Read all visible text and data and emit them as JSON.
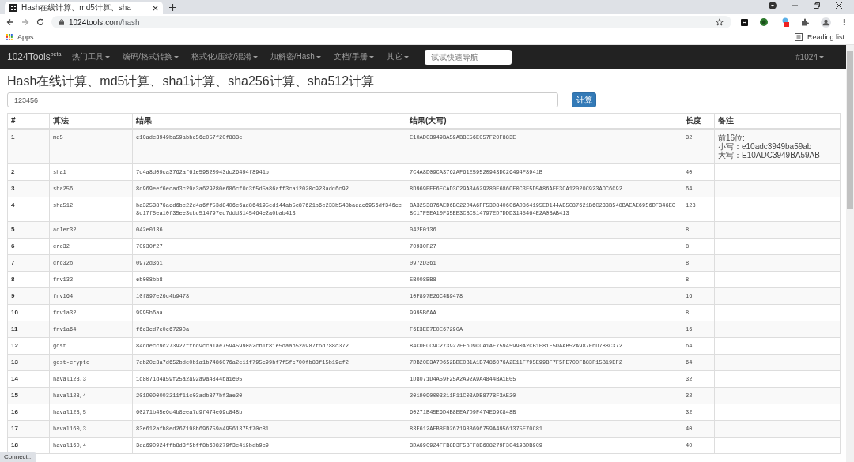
{
  "browser": {
    "tab": {
      "title": "Hash在线计算、md5计算、sha"
    },
    "url": {
      "host": "1024tools.com",
      "path": "/hash"
    },
    "bookmarks": [
      "Apps"
    ],
    "reading_list": "Reading list"
  },
  "navbar": {
    "brand": "1024Tools",
    "brand_sup": "beta",
    "menus": [
      "热门工具",
      "编码/格式转换",
      "格式化/压缩/混淆",
      "加解密/Hash",
      "文档/手册",
      "其它"
    ],
    "search_placeholder": "试试快速导航",
    "right_menu": "#1024"
  },
  "heading": "Hash在线计算、md5计算、sha1计算、sha256计算、sha512计算",
  "input": {
    "value": "123456"
  },
  "submit": "计算",
  "table": {
    "columns": [
      "#",
      "算法",
      "结果",
      "结果(大写)",
      "长度",
      "备注"
    ],
    "rows": [
      {
        "no": "1",
        "algo": "md5",
        "hash": "e10adc3949ba59abbe56e057f20f883e",
        "hash_upper": "E10ADC3949BA59ABBE56E057F20F883E",
        "length": "32",
        "note": [
          "前16位:",
          "小写：e10adc3949ba59ab",
          "大写：E10ADC3949BA59AB"
        ]
      },
      {
        "no": "2",
        "algo": "sha1",
        "hash": "7c4a8d09ca3762af61e59520943dc26494f8941b",
        "hash_upper": "7C4A8D09CA3762AF61E59520943DC26494F8941B",
        "length": "40"
      },
      {
        "no": "3",
        "algo": "sha256",
        "hash": "8d969eef6ecad3c29a3a629280e686cf0c3f5d5a86aff3ca12020c923adc6c92",
        "hash_upper": "8D969EEF6ECAD3C29A3A629280E686CF0C3F5D5A86AFF3CA12020C923ADC6C92",
        "length": "64"
      },
      {
        "no": "4",
        "algo": "sha512",
        "hash": "ba3253876aed6bc22d4a6ff53d8406c6ad864195ed144ab5c87621b6c233b548baeae6956df346ec8c17f5ea10f35ee3cbc514797ed7ddd3145464e2a0bab413",
        "hash_upper": "BA3253876AED6BC22D4A6FF53D8406C6AD864195ED144AB5C87621B6C233B548BAEAE6956DF346EC8C17F5EA10F35EE3CBC514797ED7DDD3145464E2A0BAB413",
        "length": "128"
      },
      {
        "no": "5",
        "algo": "adler32",
        "hash": "042e0136",
        "hash_upper": "042E0136",
        "length": "8"
      },
      {
        "no": "6",
        "algo": "crc32",
        "hash": "70930f27",
        "hash_upper": "70930F27",
        "length": "8"
      },
      {
        "no": "7",
        "algo": "crc32b",
        "hash": "0972d361",
        "hash_upper": "0972D361",
        "length": "8"
      },
      {
        "no": "8",
        "algo": "fnv132",
        "hash": "eb008bb8",
        "hash_upper": "EB008BB8",
        "length": "8"
      },
      {
        "no": "9",
        "algo": "fnv164",
        "hash": "10f897e26c4b9478",
        "hash_upper": "10F897E26C4B9478",
        "length": "16"
      },
      {
        "no": "10",
        "algo": "fnv1a32",
        "hash": "9995b6aa",
        "hash_upper": "9995B6AA",
        "length": "8"
      },
      {
        "no": "11",
        "algo": "fnv1a64",
        "hash": "f6e3ed7e0e67290a",
        "hash_upper": "F6E3ED7E0E67290A",
        "length": "16"
      },
      {
        "no": "12",
        "algo": "gost",
        "hash": "84cdecc9c273927ff6d9cca1ae75945990a2cb1f81e5daab52a987f6d788c372",
        "hash_upper": "84CDECC9C273927FF6D9CCA1AE75945990A2CB1F81E5DAAB52A987F6D788C372",
        "length": "64"
      },
      {
        "no": "13",
        "algo": "gost-crypto",
        "hash": "7db20e3a7d652bde0b1a1b7486076a2e11f795e99bf7f5fe700fb83f15b19ef2",
        "hash_upper": "7DB20E3A7D652BDE0B1A1B7486076A2E11F795E99BF7F5FE700FB83F15B19EF2",
        "length": "64"
      },
      {
        "no": "14",
        "algo": "haval128,3",
        "hash": "1d8071d4a59f25a2a92a9a4844ba1e05",
        "hash_upper": "1D8071D4A59F25A2A92A9A4844BA1E05",
        "length": "32"
      },
      {
        "no": "15",
        "algo": "haval128,4",
        "hash": "2019090003211f11c03adb877bf3ae20",
        "hash_upper": "2019090003211F11C03ADB877BF3AE20",
        "length": "32"
      },
      {
        "no": "16",
        "algo": "haval128,5",
        "hash": "60271b45e6d4b8eea7d9f474e69c848b",
        "hash_upper": "60271B45E6D4B8EEA7D9F474E69C848B",
        "length": "32"
      },
      {
        "no": "17",
        "algo": "haval160,3",
        "hash": "83e612afb8ed267198b696759a49561375f70c81",
        "hash_upper": "83E612AFB8ED267198B696759A49561375F70C81",
        "length": "40"
      },
      {
        "no": "18",
        "algo": "haval160,4",
        "hash": "3da690924ffb8d3f5bff8b608279f3c419bdb9c9",
        "hash_upper": "3DA690924FFB8D3F5BFF8B608279F3C419BDB9C9",
        "length": "40"
      }
    ]
  },
  "status": "Connect..."
}
